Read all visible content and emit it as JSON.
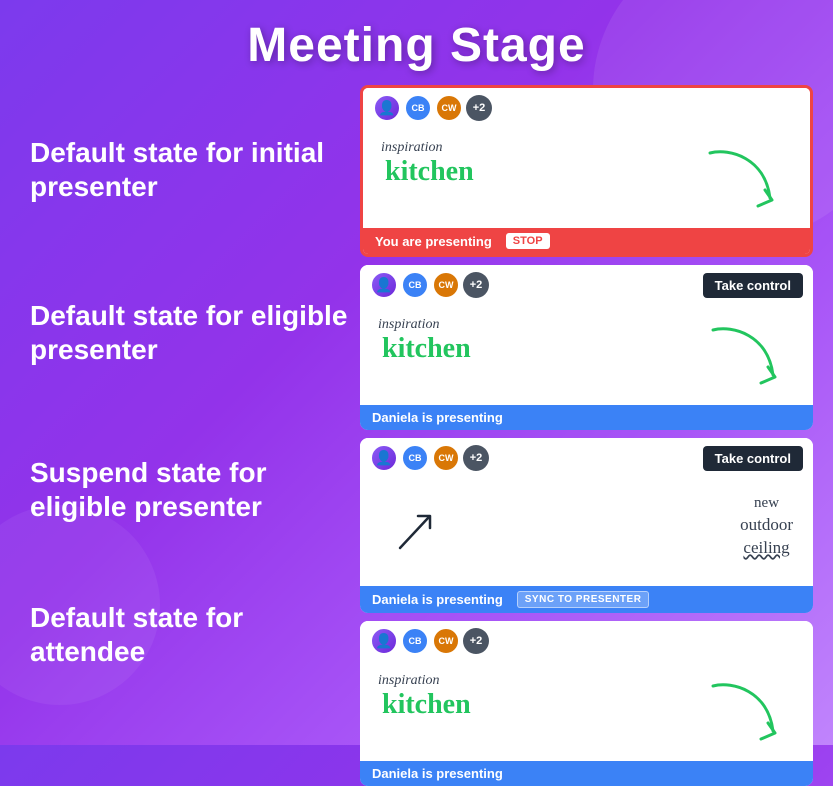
{
  "page": {
    "title": "Meeting Stage"
  },
  "labels": [
    {
      "id": "label-1",
      "text": "Default state for initial presenter"
    },
    {
      "id": "label-2",
      "text": "Default state for eligible presenter"
    },
    {
      "id": "label-3",
      "text": "Suspend state for eligible presenter"
    },
    {
      "id": "label-4",
      "text": "Default state for attendee"
    }
  ],
  "panels": [
    {
      "id": "panel-1",
      "type": "active-presenter",
      "header": {
        "avatars": [
          "user",
          "CB",
          "CW"
        ],
        "count": "+2",
        "takControl": false
      },
      "content": {
        "inspiration": "inspiration",
        "main_text": "kitchen",
        "arrow": true
      },
      "footer": {
        "type": "presenting-red",
        "text": "You are presenting",
        "action": "STOP"
      }
    },
    {
      "id": "panel-2",
      "type": "eligible-presenter",
      "header": {
        "avatars": [
          "user",
          "CB",
          "CW"
        ],
        "count": "+2",
        "takeControl": true,
        "takeControlLabel": "Take control"
      },
      "content": {
        "inspiration": "inspiration",
        "main_text": "kitchen",
        "arrow": true
      },
      "footer": {
        "type": "presenting-blue",
        "text": "Daniela is presenting",
        "action": null
      }
    },
    {
      "id": "panel-3",
      "type": "suspend-eligible",
      "header": {
        "avatars": [
          "user",
          "CB",
          "CW"
        ],
        "count": "+2",
        "takeControl": true,
        "takeControlLabel": "Take control"
      },
      "content": {
        "handwriting_lines": [
          "new",
          "outdoor",
          "ceiling"
        ],
        "arrow": true
      },
      "footer": {
        "type": "presenting-blue",
        "text": "Daniela is presenting",
        "action": "SYNC TO PRESENTER"
      }
    },
    {
      "id": "panel-4",
      "type": "attendee",
      "header": {
        "avatars": [
          "user",
          "CB",
          "CW"
        ],
        "count": "+2",
        "takeControl": false
      },
      "content": {
        "inspiration": "inspiration",
        "main_text": "kitchen",
        "arrow": true
      },
      "footer": {
        "type": "presenting-blue",
        "text": "Daniela is presenting",
        "action": null
      }
    }
  ],
  "colors": {
    "red_border": "#ef4444",
    "blue_bar": "#3b82f6",
    "red_bar": "#ef4444",
    "dark_btn": "#1f2937",
    "green_text": "#22c55e"
  }
}
